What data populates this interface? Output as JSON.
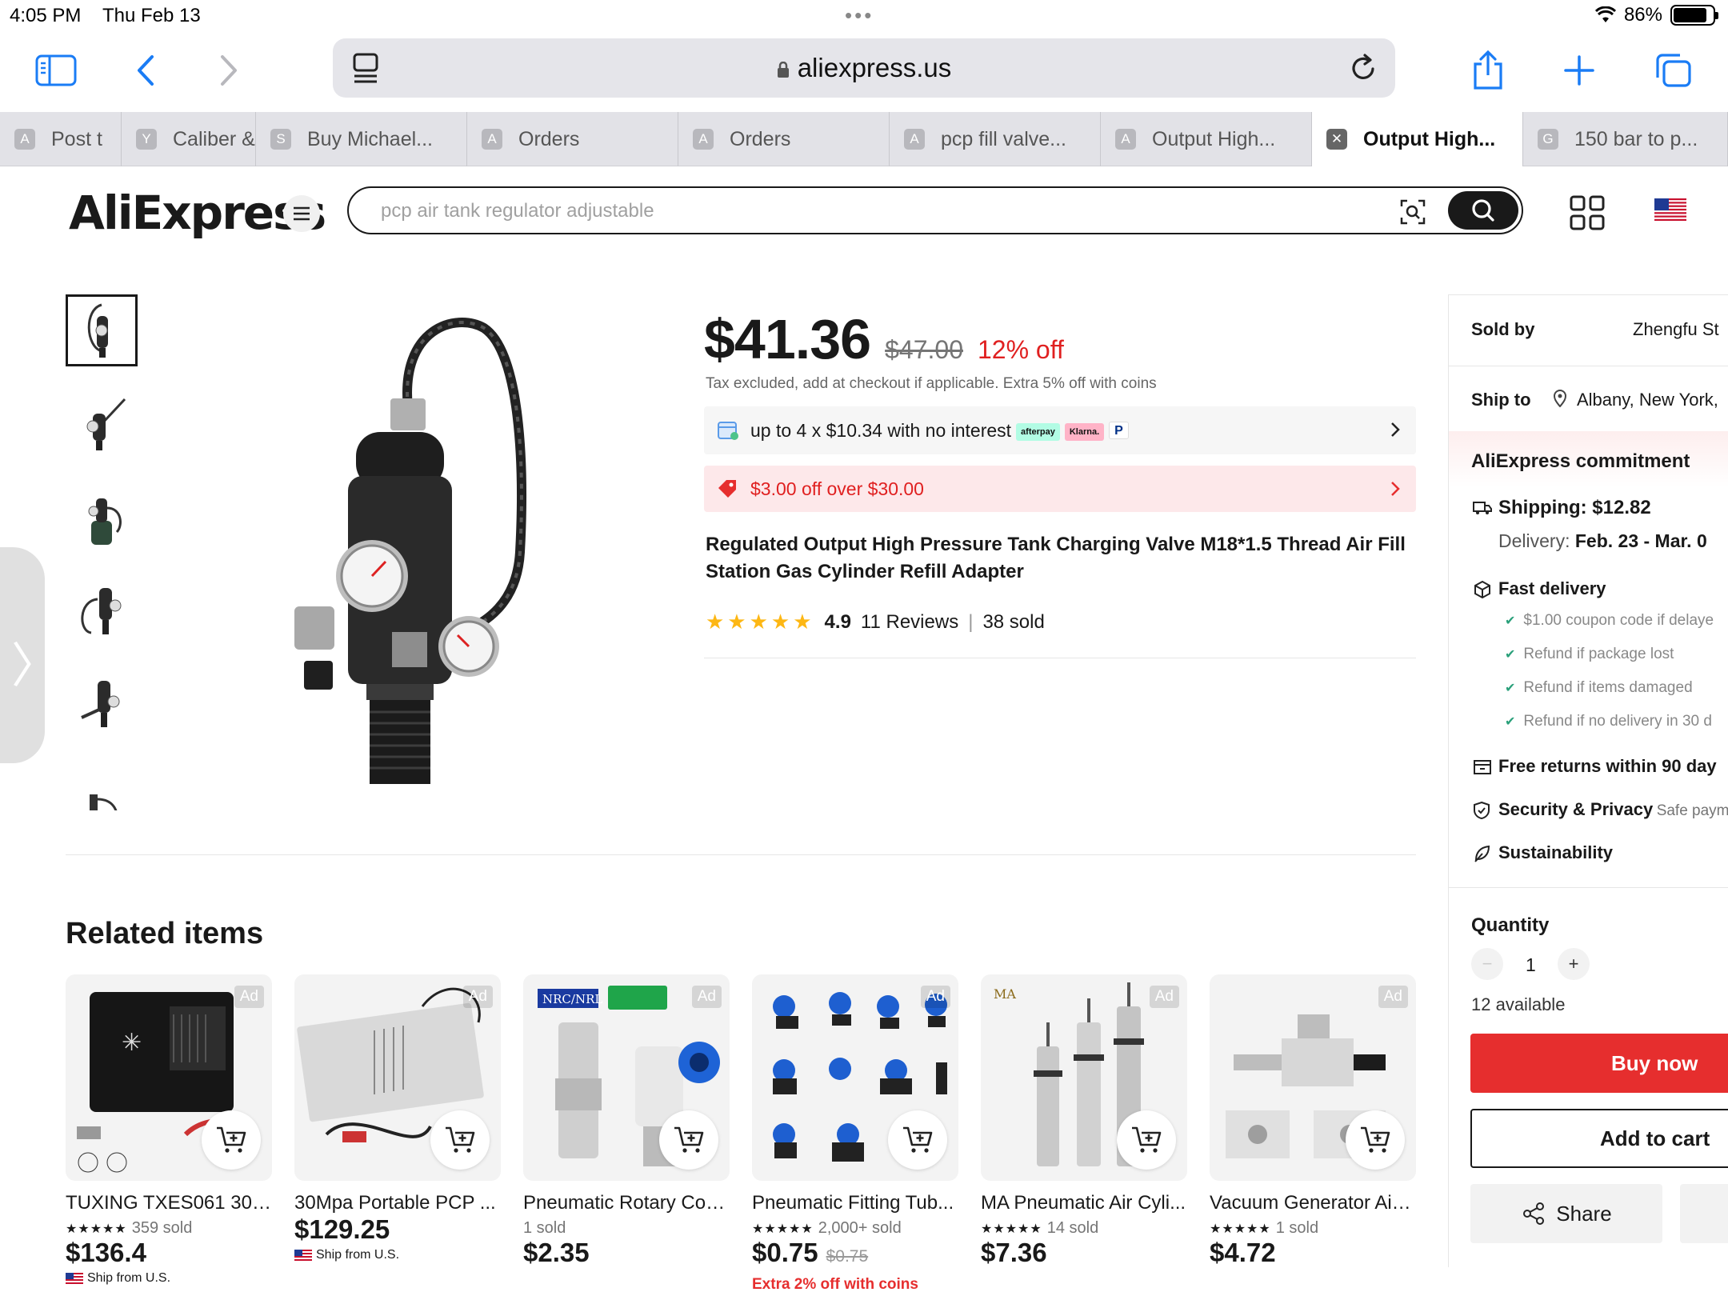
{
  "status_bar": {
    "time": "4:05 PM",
    "date": "Thu Feb 13",
    "battery": "86%"
  },
  "browser": {
    "url": "aliexpress.us",
    "tabs": [
      {
        "letter": "A",
        "label": "Post t",
        "width": 152
      },
      {
        "letter": "Y",
        "label": "Caliber &",
        "width": 168
      },
      {
        "letter": "S",
        "label": "Buy Michael...",
        "width": 264
      },
      {
        "letter": "A",
        "label": "Orders",
        "width": 264
      },
      {
        "letter": "A",
        "label": "Orders",
        "width": 264
      },
      {
        "letter": "A",
        "label": "pcp fill valve...",
        "width": 264
      },
      {
        "letter": "A",
        "label": "Output High...",
        "width": 264
      },
      {
        "letter": "✕",
        "label": "Output High...",
        "width": 264,
        "active": true
      },
      {
        "letter": "G",
        "label": "150 bar to p...",
        "width": 256
      }
    ]
  },
  "header": {
    "logo": "AliExpress",
    "search_placeholder": "pcp air tank regulator adjustable"
  },
  "product": {
    "price": "$41.36",
    "original_price": "$47.00",
    "discount": "12% off",
    "tax_note": "Tax excluded, add at checkout if applicable. Extra 5% off with coins",
    "installments": "up to 4 x $10.34 with no interest",
    "installment_chips": [
      "afterpay",
      "Klarna.",
      "P"
    ],
    "coupon": "$3.00 off over $30.00",
    "title": "Regulated Output High Pressure Tank Charging Valve M18*1.5 Thread Air Fill Station Gas Cylinder Refill Adapter",
    "stars": "★★★★★",
    "rating": "4.9",
    "reviews": "11 Reviews",
    "sold": "38 sold"
  },
  "panel": {
    "sold_by_label": "Sold by",
    "sold_by_value": "Zhengfu St",
    "ship_to_label": "Ship to",
    "ship_to_value": "Albany, New York,",
    "commitment": "AliExpress commitment",
    "shipping": "Shipping: $12.82",
    "delivery_label": "Delivery:",
    "delivery_value": "Feb. 23 - Mar. 0",
    "fast_delivery": "Fast delivery",
    "fast_items": [
      "$1.00 coupon code if delaye",
      "Refund if package lost",
      "Refund if items damaged",
      "Refund if no delivery in 30 d"
    ],
    "free_returns": "Free returns within 90 day",
    "security": "Security & Privacy",
    "security_sub": "Safe paym",
    "sustainability": "Sustainability",
    "quantity_label": "Quantity",
    "quantity_value": "1",
    "available": "12 available",
    "buy_now": "Buy now",
    "add_to_cart": "Add to cart",
    "share": "Share"
  },
  "related": {
    "title": "Related items",
    "ad_label": "Ad",
    "items": [
      {
        "name": "TUXING TXES061 300...",
        "stars": "★★★★★",
        "sold": "359 sold",
        "price": "$136.4",
        "ship": "Ship from U.S."
      },
      {
        "name": "30Mpa Portable PCP ...",
        "price": "$129.25",
        "ship": "Ship from U.S."
      },
      {
        "name": "Pneumatic Rotary Con...",
        "sold": "1 sold",
        "price": "$2.35"
      },
      {
        "name": "Pneumatic Fitting Tub...",
        "stars": "★★★★★",
        "sold": "2,000+ sold",
        "price": "$0.75",
        "strike": "$0.75",
        "coin": "Extra 2% off with coins"
      },
      {
        "name": "MA Pneumatic Air Cyli...",
        "stars": "★★★★★",
        "sold": "14 sold",
        "price": "$7.36"
      },
      {
        "name": "Vacuum Generator Air ...",
        "stars": "★★★★★",
        "sold": "1 sold",
        "price": "$4.72"
      }
    ]
  },
  "colors": {
    "accent_red": "#e62e2e",
    "star": "#fdb714",
    "ios_blue": "#1a7cf5"
  }
}
